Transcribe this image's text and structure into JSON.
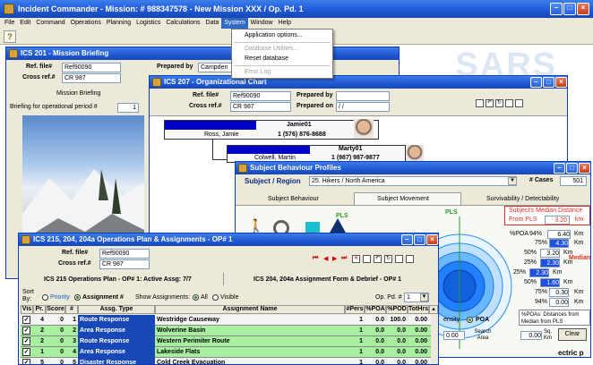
{
  "app": {
    "title": "Incident Commander - Mission: # 988347578 - New Mission XXX / Op. Pd. 1",
    "watermark": "SARS"
  },
  "menubar": [
    "File",
    "Edit",
    "Command",
    "Operations",
    "Planning",
    "Logistics",
    "Calculations",
    "Data",
    "System",
    "Window",
    "Help"
  ],
  "system_menu": {
    "items": [
      "Application options...",
      "Database Utilities...",
      "Reset database",
      "Error Log"
    ]
  },
  "ics201": {
    "title": "ICS 201 - Mission Briefing",
    "ref_label": "Ref. file#",
    "ref_value": "Ref90090",
    "cross_label": "Cross ref.#",
    "cross_value": "CR 987",
    "prepared_by_label": "Prepared by",
    "prepared_by_value": "Campden",
    "tab": "Mission Briefing",
    "period_label": "Briefing for operational period #",
    "period_value": "1"
  },
  "ics207": {
    "title": "ICS 207 - Organizational Chart",
    "ref_label": "Ref. file#",
    "ref_value": "Ref90090",
    "cross_label": "Cross ref.#",
    "cross_value": "CR 987",
    "prepared_by_label": "Prepared by",
    "prepared_on_label": "Prepared on",
    "prepared_on_value": "/ /",
    "card1_id": "Jamie01",
    "card1_name": "Ross, Jamie",
    "card1_phone": "1 (576) 876-8688",
    "card2_id": "Marty01",
    "card2_name": "Colwell, Martin",
    "card2_phone": "1 (987) 987-9877"
  },
  "subject": {
    "title": "Subject Behaviour Profiles",
    "region_label": "Subject / Region",
    "region_value": "25. Hikers / North America",
    "cases_label": "# Cases",
    "cases_value": "501",
    "tabs": [
      "Subject Behaviour",
      "Subject Movement",
      "Survivability / Detectability"
    ],
    "pls_label": "PLS",
    "median_title": "Subject's Median Distance",
    "median_from": "From PLS",
    "median_value": "3.20",
    "median_unit": "km",
    "median_tag": "Median",
    "pct_poa_label": "%POA",
    "pct_poa_value": "94%",
    "pct_poa_num": "6.40",
    "rings": [
      {
        "pct": "75%",
        "val": "4.30"
      },
      {
        "pct": "50%",
        "val": "3.20"
      },
      {
        "pct": "25%",
        "val": "2.30"
      },
      {
        "pct": "25%",
        "val": "2.30"
      },
      {
        "pct": "50%",
        "val": "1.60"
      },
      {
        "pct": "75%",
        "val": "0.30"
      },
      {
        "pct": "94%",
        "val": "0.00"
      }
    ],
    "km_unit": "Km",
    "poa_distances": "%POAs: Distances from Median from PLS",
    "density_label": "ensity",
    "poa_radio": "POA",
    "search_area_label": "Search Area",
    "search_area_value": "0.00",
    "area_left_value": "0.00",
    "sq_km": "Sq. Km",
    "clear_button": "Clear",
    "bottom_text": "ectric p"
  },
  "ics215": {
    "title": "ICS 215, 204, 204a Operations Plan & Assignments - OP# 1",
    "ref_label": "Ref. file#",
    "ref_value": "Ref90090",
    "cross_label": "Cross ref.#",
    "cross_value": "CR 987",
    "tab_left": "ICS 215 Operations Plan - OP# 1: Active Assg: 7/7",
    "tab_right": "ICS 204, 204a Assignment Form & Debrief - OP# 1",
    "sort_label": "Sort By:",
    "sort_priority": "Priority",
    "sort_assignment": "Assignment #",
    "show_label": "Show Assignments:",
    "show_all": "All",
    "show_visible": "Visible",
    "op_pd_label": "Op. Pd. #",
    "op_pd_value": "1",
    "columns": [
      "Vis",
      "Pr.",
      "Score",
      "#",
      "Assg. Type",
      "Assignment Name",
      "#Pers",
      "%POA",
      "%POD",
      "TotHrs"
    ],
    "rows": [
      {
        "pr": "4",
        "score": "0",
        "num": "1",
        "type": "Route Response",
        "name": "Westridge Causeway",
        "pers": "1",
        "poa": "0.0",
        "pod": "100.0",
        "hrs": "0.00",
        "color": "#f4f4f4"
      },
      {
        "pr": "2",
        "score": "0",
        "num": "2",
        "type": "Area Response",
        "name": "Wolverine Basin",
        "pers": "1",
        "poa": "0.0",
        "pod": "0.0",
        "hrs": "0.00",
        "color": "#a8f0a0"
      },
      {
        "pr": "2",
        "score": "0",
        "num": "3",
        "type": "Route Response",
        "name": "Western Perimiter Route",
        "pers": "1",
        "poa": "0.0",
        "pod": "0.0",
        "hrs": "0.00",
        "color": "#a8f0a0"
      },
      {
        "pr": "1",
        "score": "0",
        "num": "4",
        "type": "Area Response",
        "name": "Lakeside Flats",
        "pers": "1",
        "poa": "0.0",
        "pod": "0.0",
        "hrs": "0.00",
        "color": "#a8f0a0"
      },
      {
        "pr": "5",
        "score": "0",
        "num": "5",
        "type": "Disaster Response",
        "name": "Cold Creek Evacuation",
        "pers": "1",
        "poa": "0.0",
        "pod": "0.0",
        "hrs": "0.00",
        "color": "#f4f4f4"
      }
    ]
  },
  "colors": {
    "titlebar": "#2058d8",
    "row_green": "#a8f0a0",
    "median_red": "#e03020",
    "ring_blue": "#1e90ff"
  }
}
